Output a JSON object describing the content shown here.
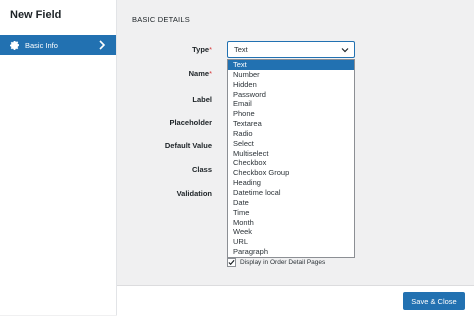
{
  "modal": {
    "title": "New Field"
  },
  "sidebar": {
    "items": [
      {
        "label": "Basic Info",
        "icon": "gear-icon",
        "active": true
      }
    ]
  },
  "section": {
    "title": "BASIC DETAILS"
  },
  "labels": {
    "type": "Type",
    "name": "Name",
    "label": "Label",
    "placeholder": "Placeholder",
    "default_value": "Default Value",
    "class": "Class",
    "validation": "Validation",
    "required_mark": "*"
  },
  "type_select": {
    "value": "Text",
    "options": [
      "Text",
      "Number",
      "Hidden",
      "Password",
      "Email",
      "Phone",
      "Textarea",
      "Radio",
      "Select",
      "Multiselect",
      "Checkbox",
      "Checkbox Group",
      "Heading",
      "Datetime local",
      "Date",
      "Time",
      "Month",
      "Week",
      "URL",
      "Paragraph"
    ]
  },
  "checkbox": {
    "label": "Display in Order Detail Pages",
    "checked": true
  },
  "footer": {
    "save_label": "Save & Close"
  },
  "colors": {
    "accent": "#2271b1",
    "required": "#d63638"
  }
}
